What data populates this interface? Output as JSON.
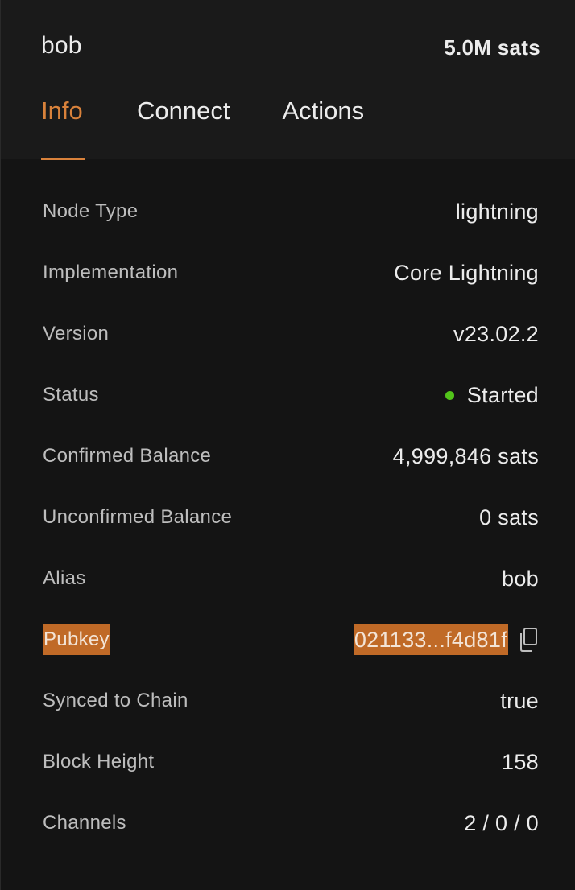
{
  "node": {
    "name": "bob",
    "balance": "5.0M sats"
  },
  "tabs": [
    {
      "label": "Info",
      "active": true
    },
    {
      "label": "Connect",
      "active": false
    },
    {
      "label": "Actions",
      "active": false
    }
  ],
  "details": {
    "node_type": {
      "label": "Node Type",
      "value": "lightning"
    },
    "implementation": {
      "label": "Implementation",
      "value": "Core Lightning"
    },
    "version": {
      "label": "Version",
      "value": "v23.02.2"
    },
    "status": {
      "label": "Status",
      "value": "Started",
      "indicator_color": "#52c41a"
    },
    "confirmed_balance": {
      "label": "Confirmed Balance",
      "value": "4,999,846 sats"
    },
    "unconfirmed_balance": {
      "label": "Unconfirmed Balance",
      "value": "0 sats"
    },
    "alias": {
      "label": "Alias",
      "value": "bob"
    },
    "pubkey": {
      "label": "Pubkey",
      "value": "021133...f4d81f",
      "copy_icon": "copy-icon"
    },
    "synced_to_chain": {
      "label": "Synced to Chain",
      "value": "true"
    },
    "block_height": {
      "label": "Block Height",
      "value": "158"
    },
    "channels": {
      "label": "Channels",
      "value": "2 / 0 / 0"
    }
  },
  "colors": {
    "accent": "#d9823b",
    "selection": "#c06a27",
    "background": "#141414"
  }
}
